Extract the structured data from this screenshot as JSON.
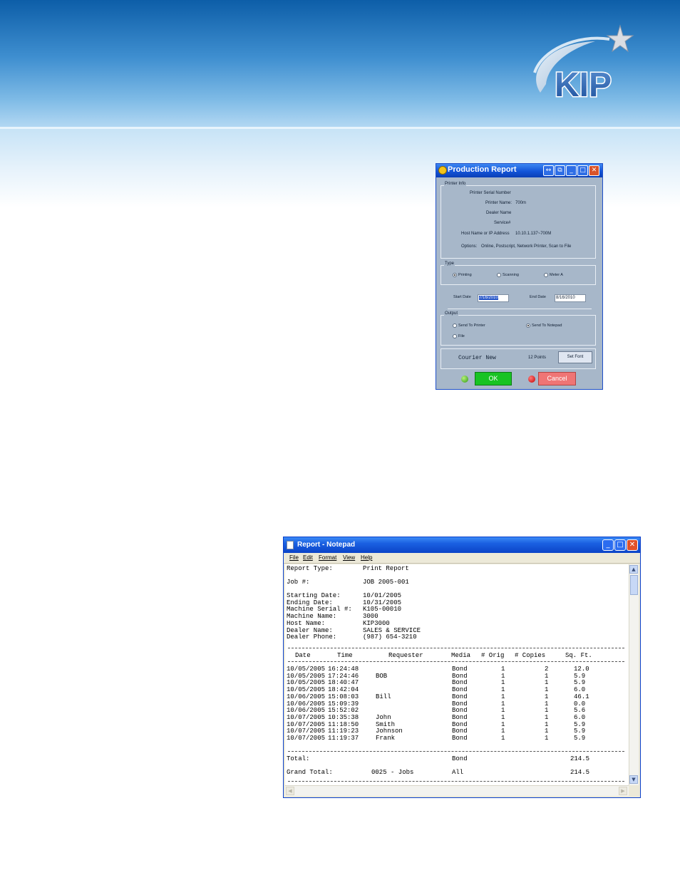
{
  "banner": {
    "logo_text": "KIP",
    "colors": {
      "top": "#0d5ea8",
      "bottom": "#b5d9f3",
      "logo_blue": "#1b4f9c"
    }
  },
  "production_dialog": {
    "title": "Production Report",
    "printer_info": {
      "group_label": "Printer Info",
      "serial_label": "Printer Serial Number",
      "name_label": "Printer Name:",
      "name_value": "700m",
      "dealer_label": "Dealer Name",
      "service_label": "Service#",
      "host_label": "Host Name or IP Address",
      "host_value": "10.10.1.137~700M",
      "options_label": "Options:",
      "options_value": "Online, Postscript, Network Printer, Scan to File"
    },
    "type_group": {
      "label": "Type",
      "options": [
        {
          "label": "Printing",
          "selected": true
        },
        {
          "label": "Scanning",
          "selected": false
        },
        {
          "label": "Meter A",
          "selected": false
        }
      ]
    },
    "dates": {
      "start_label": "Start Date",
      "start_value": "7/16/2010",
      "end_label": "End Date",
      "end_value": "8/16/2010"
    },
    "output_group": {
      "label": "Output",
      "send_to_printer": {
        "label": "Send To Printer",
        "selected": false
      },
      "send_to_notepad": {
        "label": "Send To Notepad",
        "selected": true
      },
      "file": {
        "label": "File",
        "selected": false
      }
    },
    "font": {
      "name": "Courier New",
      "size": "12 Points",
      "set_font_label": "Set Font"
    },
    "ok_label": "OK",
    "cancel_label": "Cancel"
  },
  "notepad": {
    "title": "Report - Notepad",
    "menu": [
      "File",
      "Edit",
      "Format",
      "View",
      "Help"
    ],
    "report_type": {
      "label": "Report Type:",
      "value": "Print Report"
    },
    "job": {
      "label": "Job #:",
      "value": "JOB 2005-001"
    },
    "meta": [
      {
        "label": "Starting Date:",
        "value": "10/01/2005"
      },
      {
        "label": "Ending Date:",
        "value": "10/31/2005"
      },
      {
        "label": "Machine Serial #:",
        "value": "K105-00010"
      },
      {
        "label": "Machine Name:",
        "value": "3000"
      },
      {
        "label": "Host Name:",
        "value": "KIP3000"
      },
      {
        "label": "Dealer Name:",
        "value": "SALES & SERVICE"
      },
      {
        "label": "Dealer Phone:",
        "value": "(987) 654-3210"
      }
    ],
    "columns": [
      "Date",
      "Time",
      "Requester",
      "Media",
      "# Orig",
      "# Copies",
      "Sq. Ft."
    ],
    "rows": [
      {
        "date": "10/05/2005",
        "time": "16:24:48",
        "requester": "",
        "media": "Bond",
        "orig": "1",
        "copies": "2",
        "sqft": "12.0"
      },
      {
        "date": "10/05/2005",
        "time": "17:24:46",
        "requester": "BOB",
        "media": "Bond",
        "orig": "1",
        "copies": "1",
        "sqft": "5.9"
      },
      {
        "date": "10/05/2005",
        "time": "18:40:47",
        "requester": "",
        "media": "Bond",
        "orig": "1",
        "copies": "1",
        "sqft": "5.9"
      },
      {
        "date": "10/05/2005",
        "time": "18:42:04",
        "requester": "",
        "media": "Bond",
        "orig": "1",
        "copies": "1",
        "sqft": "6.0"
      },
      {
        "date": "10/06/2005",
        "time": "15:08:03",
        "requester": "Bill",
        "media": "Bond",
        "orig": "1",
        "copies": "1",
        "sqft": "46.1"
      },
      {
        "date": "10/06/2005",
        "time": "15:09:39",
        "requester": "",
        "media": "Bond",
        "orig": "1",
        "copies": "1",
        "sqft": "0.0"
      },
      {
        "date": "10/06/2005",
        "time": "15:52:02",
        "requester": "",
        "media": "Bond",
        "orig": "1",
        "copies": "1",
        "sqft": "5.6"
      },
      {
        "date": "10/07/2005",
        "time": "10:35:38",
        "requester": "John",
        "media": "Bond",
        "orig": "1",
        "copies": "1",
        "sqft": "6.0"
      },
      {
        "date": "10/07/2005",
        "time": "11:18:50",
        "requester": "Smith",
        "media": "Bond",
        "orig": "1",
        "copies": "1",
        "sqft": "5.9"
      },
      {
        "date": "10/07/2005",
        "time": "11:19:23",
        "requester": "Johnson",
        "media": "Bond",
        "orig": "1",
        "copies": "1",
        "sqft": "5.9"
      },
      {
        "date": "10/07/2005",
        "time": "11:19:37",
        "requester": "Frank",
        "media": "Bond",
        "orig": "1",
        "copies": "1",
        "sqft": "5.9"
      }
    ],
    "total": {
      "label": "Total:",
      "media": "Bond",
      "value": "214.5"
    },
    "grand_total": {
      "label": "Grand Total:",
      "jobs": "0025 - Jobs",
      "media": "All",
      "value": "214.5"
    }
  }
}
